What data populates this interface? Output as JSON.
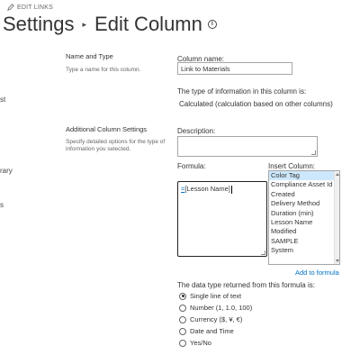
{
  "header": {
    "edit_links": "EDIT LINKS",
    "title": "Settings",
    "separator": "▸",
    "subtitle": "Edit Column",
    "info_glyph": "i"
  },
  "left_fragments": [
    "st",
    "rary",
    "s"
  ],
  "name_type": {
    "heading": "Name and Type",
    "description": "Type a name for this column.",
    "column_name_label": "Column name:",
    "column_name_value": "Link to Materials",
    "type_info_label": "The type of information in this column is:",
    "type_info_value": "Calculated (calculation based on other columns)"
  },
  "additional": {
    "heading": "Additional Column Settings",
    "description": "Specify detailed options for the type of information you selected.",
    "description_label": "Description:",
    "formula_label": "Formula:",
    "formula_eq": "=",
    "formula_rest": "[Lesson Name]",
    "insert_column_label": "Insert Column:",
    "insert_columns": [
      "Color Tag",
      "Compliance Asset Id",
      "Created",
      "Delivery Method",
      "Duration (min)",
      "Lesson Name",
      "Modified",
      "SAMPLE",
      "System"
    ],
    "selected_column": "Color Tag",
    "add_to_formula": "Add to formula",
    "return_type_label": "The data type returned from this formula is:",
    "return_types": [
      "Single line of text",
      "Number (1, 1.0, 100)",
      "Currency ($, ¥, €)",
      "Date and Time",
      "Yes/No"
    ],
    "selected_return_type": "Single line of text"
  },
  "colors": {
    "link": "#0072c6",
    "selection": "#cde8fc"
  }
}
